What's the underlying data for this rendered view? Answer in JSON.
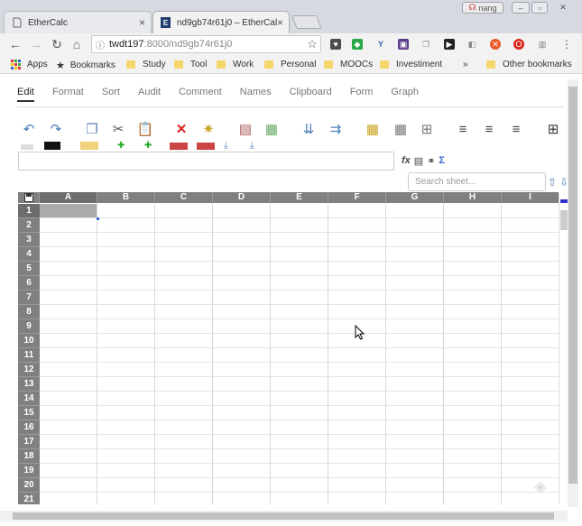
{
  "browser": {
    "tabs": [
      {
        "title": "EtherCalc",
        "active": false
      },
      {
        "title": "nd9gb74r61j0 – EtherCal",
        "active": true
      }
    ],
    "profile_name": "nang",
    "address": {
      "host": "twdt197",
      "path": ":8000/nd9gb74r61j0"
    },
    "bookmarks": [
      "Apps",
      "Bookmarks",
      "Study",
      "Tool",
      "Work",
      "Personal",
      "MOOCs",
      "Investiment",
      "Other bookmarks"
    ],
    "overflow": "»"
  },
  "app": {
    "menu_tabs": [
      "Edit",
      "Format",
      "Sort",
      "Audit",
      "Comment",
      "Names",
      "Clipboard",
      "Form",
      "Graph"
    ],
    "selected_tab": "Edit",
    "search_placeholder": "Search sheet...",
    "formula_value": ""
  },
  "sheet": {
    "columns": [
      "A",
      "B",
      "C",
      "D",
      "E",
      "F",
      "G",
      "H",
      "I"
    ],
    "rows": [
      "1",
      "2",
      "3",
      "4",
      "5",
      "6",
      "7",
      "8",
      "9",
      "10",
      "11",
      "12",
      "13",
      "14",
      "15",
      "16",
      "17",
      "18",
      "19",
      "20",
      "21"
    ],
    "selected_cell": "A1"
  },
  "colors": {
    "header_bg": "#808080",
    "selected_header": "#6d6d6d",
    "folder": "#f5d66b"
  }
}
